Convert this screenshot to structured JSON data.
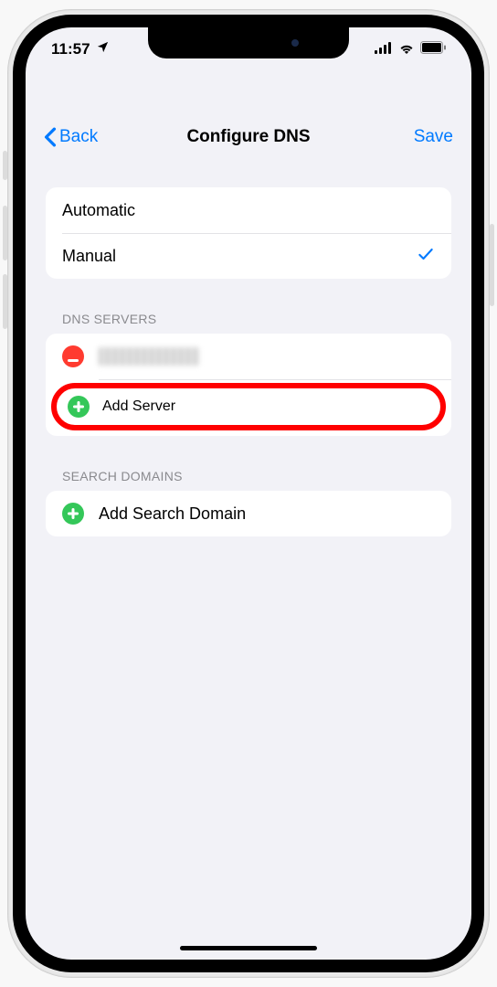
{
  "status": {
    "time": "11:57",
    "location_icon": "location-arrow",
    "signal_icon": "cellular-signal",
    "wifi_icon": "wifi",
    "battery_icon": "battery-full"
  },
  "nav": {
    "back_label": "Back",
    "title": "Configure DNS",
    "save_label": "Save"
  },
  "dns_mode": {
    "options": [
      "Automatic",
      "Manual"
    ],
    "selected": "Manual"
  },
  "sections": {
    "servers_header": "DNS SERVERS",
    "domains_header": "SEARCH DOMAINS"
  },
  "servers": {
    "existing_redacted": true,
    "add_label": "Add Server"
  },
  "domains": {
    "add_label": "Add Search Domain"
  },
  "colors": {
    "accent": "#007aff",
    "green": "#34c759",
    "red": "#ff3b30",
    "highlight": "#ff0000",
    "bg": "#f2f2f7"
  }
}
